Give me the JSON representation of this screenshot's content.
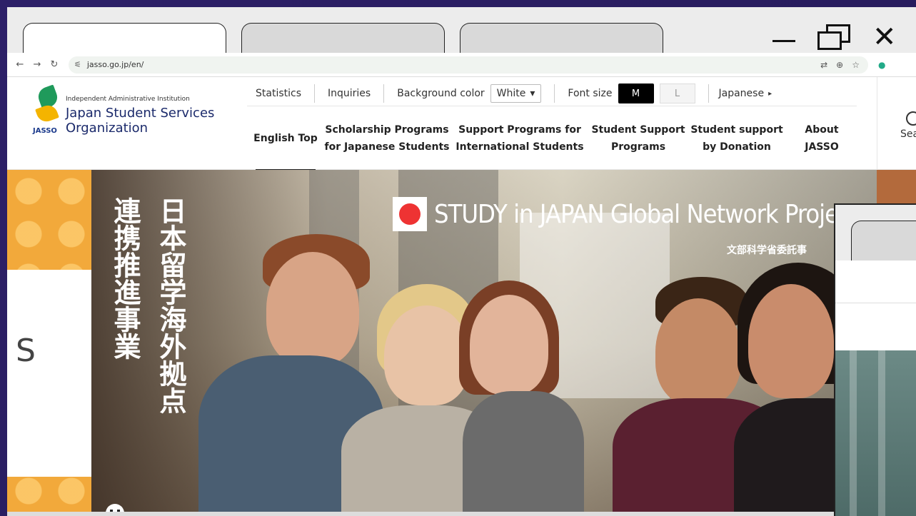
{
  "browser": {
    "url": "jasso.go.jp/en/"
  },
  "header": {
    "logo": {
      "sub": "Independent Administrative Institution",
      "line1": "Japan Student Services",
      "line2": "Organization",
      "mark": "JASSO"
    },
    "utility": {
      "statistics": "Statistics",
      "inquiries": "Inquiries",
      "background_color_label": "Background color",
      "background_color_value": "White",
      "font_size_label": "Font size",
      "font_size_m": "M",
      "font_size_l": "L",
      "language": "Japanese"
    },
    "nav": [
      {
        "label": "English Top"
      },
      {
        "label": "Scholarship Programs for Japanese Students"
      },
      {
        "label": "Support Programs for International Students"
      },
      {
        "label": "Student Support Programs"
      },
      {
        "label": "Student support by Donation"
      },
      {
        "label": "About JASSO"
      }
    ],
    "search_label": "Sea"
  },
  "hero": {
    "vertical_text_1": "日本留学海外拠点",
    "vertical_text_2": "連携推進事業",
    "title": "STUDY in JAPAN Global Network Projec",
    "subtitle": "文部科学省委託事",
    "left_letter": "S"
  }
}
